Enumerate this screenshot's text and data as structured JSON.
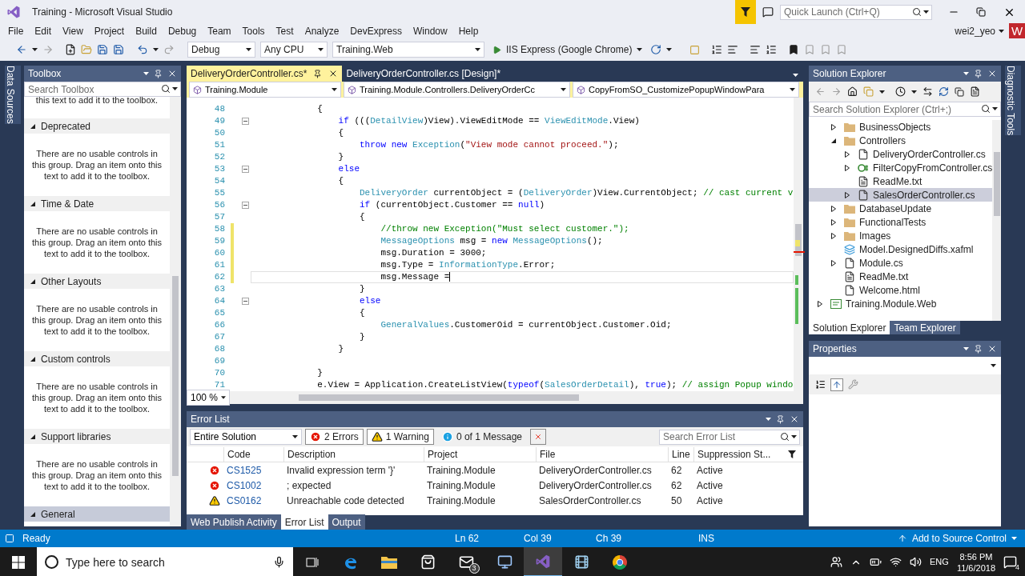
{
  "window": {
    "title": "Training - Microsoft Visual Studio"
  },
  "quick_launch": {
    "placeholder": "Quick Launch (Ctrl+Q)"
  },
  "menu": [
    "File",
    "Edit",
    "View",
    "Project",
    "Build",
    "Debug",
    "Team",
    "Tools",
    "Test",
    "Analyze",
    "DevExpress",
    "Window",
    "Help"
  ],
  "account": {
    "user": "wei2_yeo",
    "initial": "W"
  },
  "toolbar": {
    "configuration": "Debug",
    "platform": "Any CPU",
    "startup_project": "Training.Web",
    "run_target": "IIS Express (Google Chrome)"
  },
  "left_side_tabs": [
    "Data Sources"
  ],
  "right_side_tabs": [
    "Diagnostic Tools"
  ],
  "toolbox": {
    "title": "Toolbox",
    "search": {
      "placeholder": "Search Toolbox"
    },
    "top_text": "this text to add it to the toolbox.",
    "groups": [
      {
        "name": "Deprecated",
        "expanded": true,
        "selected": false,
        "message": "There are no usable controls in this group. Drag an item onto this text to add it to the toolbox."
      },
      {
        "name": "Time & Date",
        "expanded": true,
        "selected": false,
        "message": "There are no usable controls in this group. Drag an item onto this text to add it to the toolbox."
      },
      {
        "name": "Other Layouts",
        "expanded": true,
        "selected": false,
        "message": "There are no usable controls in this group. Drag an item onto this text to add it to the toolbox."
      },
      {
        "name": "Custom controls",
        "expanded": true,
        "selected": false,
        "message": "There are no usable controls in this group. Drag an item onto this text to add it to the toolbox."
      },
      {
        "name": "Support libraries",
        "expanded": true,
        "selected": false,
        "message": "There are no usable controls in this group. Drag an item onto this text to add it to the toolbox."
      },
      {
        "name": "General",
        "expanded": true,
        "selected": true
      }
    ]
  },
  "editor": {
    "tabs": [
      {
        "label": "DeliveryOrderController.cs*",
        "selected": true
      },
      {
        "label": "DeliveryOrderController.cs [Design]*",
        "selected": false
      }
    ],
    "navigation": [
      "Training.Module",
      "Training.Module.Controllers.DeliveryOrderCc",
      "CopyFromSO_CustomizePopupWindowPara"
    ],
    "lines": [
      {
        "number": "48",
        "changed": false,
        "fold": false,
        "current": false,
        "tokens": [
          {
            "kind": "plain",
            "text": "            {"
          }
        ]
      },
      {
        "number": "49",
        "changed": false,
        "fold": true,
        "current": false,
        "tokens": [
          {
            "kind": "keyword",
            "text": "                if"
          },
          {
            "kind": "plain",
            "text": " ((("
          },
          {
            "kind": "type",
            "text": "DetailView"
          },
          {
            "kind": "plain",
            "text": ")View).ViewEditMode == "
          },
          {
            "kind": "type",
            "text": "ViewEditMode"
          },
          {
            "kind": "plain",
            "text": ".View)"
          }
        ]
      },
      {
        "number": "50",
        "changed": false,
        "fold": false,
        "current": false,
        "tokens": [
          {
            "kind": "plain",
            "text": "                {"
          }
        ]
      },
      {
        "number": "51",
        "changed": false,
        "fold": false,
        "current": false,
        "tokens": [
          {
            "kind": "keyword",
            "text": "                    throw"
          },
          {
            "kind": "keyword",
            "text": " new"
          },
          {
            "kind": "type",
            "text": " Exception"
          },
          {
            "kind": "plain",
            "text": "("
          },
          {
            "kind": "string",
            "text": "\"View mode cannot proceed.\""
          },
          {
            "kind": "plain",
            "text": ");"
          }
        ]
      },
      {
        "number": "52",
        "changed": false,
        "fold": false,
        "current": false,
        "tokens": [
          {
            "kind": "plain",
            "text": "                }"
          }
        ]
      },
      {
        "number": "53",
        "changed": false,
        "fold": true,
        "current": false,
        "tokens": [
          {
            "kind": "keyword",
            "text": "                else"
          }
        ]
      },
      {
        "number": "54",
        "changed": false,
        "fold": false,
        "current": false,
        "tokens": [
          {
            "kind": "plain",
            "text": "                {"
          }
        ]
      },
      {
        "number": "55",
        "changed": false,
        "fold": false,
        "current": false,
        "tokens": [
          {
            "kind": "type",
            "text": "                    DeliveryOrder"
          },
          {
            "kind": "plain",
            "text": " currentObject = ("
          },
          {
            "kind": "type",
            "text": "DeliveryOrder"
          },
          {
            "kind": "plain",
            "text": ")View.CurrentObject; "
          },
          {
            "kind": "comment",
            "text": "// cast current v"
          }
        ]
      },
      {
        "number": "56",
        "changed": false,
        "fold": true,
        "current": false,
        "tokens": [
          {
            "kind": "keyword",
            "text": "                    if"
          },
          {
            "kind": "plain",
            "text": " (currentObject.Customer == "
          },
          {
            "kind": "keyword",
            "text": "null"
          },
          {
            "kind": "plain",
            "text": ")"
          }
        ]
      },
      {
        "number": "57",
        "changed": false,
        "fold": false,
        "current": false,
        "tokens": [
          {
            "kind": "plain",
            "text": "                    {"
          }
        ]
      },
      {
        "number": "58",
        "changed": true,
        "fold": false,
        "current": false,
        "tokens": [
          {
            "kind": "comment",
            "text": "                        //throw new Exception(\"Must select customer.\");"
          }
        ]
      },
      {
        "number": "59",
        "changed": true,
        "fold": false,
        "current": false,
        "tokens": [
          {
            "kind": "type",
            "text": "                        MessageOptions"
          },
          {
            "kind": "plain",
            "text": " msg = "
          },
          {
            "kind": "keyword",
            "text": "new"
          },
          {
            "kind": "type",
            "text": " MessageOptions"
          },
          {
            "kind": "plain",
            "text": "();"
          }
        ]
      },
      {
        "number": "60",
        "changed": true,
        "fold": false,
        "current": false,
        "tokens": [
          {
            "kind": "plain",
            "text": "                        msg.Duration = 3000;"
          }
        ]
      },
      {
        "number": "61",
        "changed": true,
        "fold": false,
        "current": false,
        "tokens": [
          {
            "kind": "plain",
            "text": "                        msg.Type = "
          },
          {
            "kind": "type",
            "text": "InformationType"
          },
          {
            "kind": "plain",
            "text": ".Error;"
          }
        ]
      },
      {
        "number": "62",
        "changed": true,
        "fold": false,
        "current": true,
        "tokens": [
          {
            "kind": "plain",
            "text": "                        msg.Message ="
          }
        ]
      },
      {
        "number": "63",
        "changed": false,
        "fold": false,
        "current": false,
        "tokens": [
          {
            "kind": "plain",
            "text": "                    }"
          }
        ]
      },
      {
        "number": "64",
        "changed": false,
        "fold": true,
        "current": false,
        "tokens": [
          {
            "kind": "keyword",
            "text": "                    else"
          }
        ]
      },
      {
        "number": "65",
        "changed": false,
        "fold": false,
        "current": false,
        "tokens": [
          {
            "kind": "plain",
            "text": "                    {"
          }
        ]
      },
      {
        "number": "66",
        "changed": false,
        "fold": false,
        "current": false,
        "tokens": [
          {
            "kind": "type",
            "text": "                        GeneralValues"
          },
          {
            "kind": "plain",
            "text": ".CustomerOid = currentObject.Customer.Oid;"
          }
        ]
      },
      {
        "number": "67",
        "changed": false,
        "fold": false,
        "current": false,
        "tokens": [
          {
            "kind": "plain",
            "text": "                    }"
          }
        ]
      },
      {
        "number": "68",
        "changed": false,
        "fold": false,
        "current": false,
        "tokens": [
          {
            "kind": "plain",
            "text": "                }"
          }
        ]
      },
      {
        "number": "69",
        "changed": false,
        "fold": false,
        "current": false
      },
      {
        "number": "70",
        "changed": false,
        "fold": false,
        "current": false,
        "tokens": [
          {
            "kind": "plain",
            "text": "            }"
          }
        ]
      },
      {
        "number": "71",
        "changed": false,
        "fold": false,
        "current": false,
        "tokens": [
          {
            "kind": "plain",
            "text": "            e.View = Application.CreateListView("
          },
          {
            "kind": "keyword",
            "text": "typeof"
          },
          {
            "kind": "plain",
            "text": "("
          },
          {
            "kind": "type",
            "text": "SalesOrderDetail"
          },
          {
            "kind": "plain",
            "text": "), "
          },
          {
            "kind": "keyword",
            "text": "true"
          },
          {
            "kind": "plain",
            "text": "); "
          },
          {
            "kind": "comment",
            "text": "// assign Popup windo"
          }
        ]
      }
    ],
    "zoom": "100 %"
  },
  "error_list": {
    "title": "Error List",
    "scope": "Entire Solution",
    "filters": [
      {
        "kind": "error",
        "label": "2 Errors",
        "selected": true
      },
      {
        "kind": "warning",
        "label": "1 Warning",
        "selected": true
      },
      {
        "kind": "info",
        "label": "0 of 1 Message",
        "selected": false
      }
    ],
    "search": {
      "placeholder": "Search Error List"
    },
    "columns": [
      "Code",
      "Description",
      "Project",
      "File",
      "Line",
      "Suppression St..."
    ],
    "rows": [
      {
        "kind": "error",
        "code": "CS1525",
        "description": "Invalid expression term '}'",
        "project": "Training.Module",
        "file": "DeliveryOrderController.cs",
        "line": "62",
        "suppression": "Active"
      },
      {
        "kind": "error",
        "code": "CS1002",
        "description": "; expected",
        "project": "Training.Module",
        "file": "DeliveryOrderController.cs",
        "line": "62",
        "suppression": "Active"
      },
      {
        "kind": "warning",
        "code": "CS0162",
        "description": "Unreachable code detected",
        "project": "Training.Module",
        "file": "SalesOrderController.cs",
        "line": "50",
        "suppression": "Active"
      }
    ]
  },
  "bottom_tabs": [
    {
      "label": "Web Publish Activity",
      "selected": false
    },
    {
      "label": "Error List",
      "selected": true
    },
    {
      "label": "Output",
      "selected": false
    }
  ],
  "solution_explorer": {
    "title": "Solution Explorer",
    "search": {
      "placeholder": "Search Solution Explorer (Ctrl+;)"
    },
    "module_items": [
      {
        "label": "BusinessObjects",
        "kind": "folder",
        "expanded": false,
        "selected": false
      },
      {
        "label": "Controllers",
        "kind": "folder",
        "expanded": true,
        "selected": false,
        "children": [
          {
            "label": "DeliveryOrderController.cs",
            "kind": "code-file",
            "expanded": false,
            "selected": false
          },
          {
            "label": "FilterCopyFromController.cs",
            "kind": "csharp-file",
            "expanded": false,
            "selected": false
          },
          {
            "label": "ReadMe.txt",
            "kind": "text-file",
            "selected": false
          },
          {
            "label": "SalesOrderController.cs",
            "kind": "code-file",
            "expanded": false,
            "selected": true
          }
        ]
      },
      {
        "label": "DatabaseUpdate",
        "kind": "folder",
        "expanded": false,
        "selected": false
      },
      {
        "label": "FunctionalTests",
        "kind": "folder",
        "expanded": false,
        "selected": false
      },
      {
        "label": "Images",
        "kind": "folder",
        "expanded": false,
        "selected": false
      },
      {
        "label": "Model.DesignedDiffs.xafml",
        "kind": "model",
        "selected": false
      },
      {
        "label": "Module.cs",
        "kind": "code-file",
        "expanded": false,
        "selected": false
      },
      {
        "label": "ReadMe.txt",
        "kind": "text-file",
        "selected": false
      },
      {
        "label": "Welcome.html",
        "kind": "code-file",
        "selected": false
      }
    ],
    "projects": [
      {
        "label": "Training.Module.Web",
        "kind": "project",
        "expanded": false,
        "selected": false
      }
    ],
    "tabs": [
      {
        "label": "Solution Explorer",
        "selected": true
      },
      {
        "label": "Team Explorer",
        "selected": false
      }
    ]
  },
  "properties": {
    "title": "Properties"
  },
  "status_bar": {
    "state": "Ready",
    "line": "Ln 62",
    "column": "Col 39",
    "char": "Ch 39",
    "mode": "INS",
    "source_control": "Add to Source Control"
  },
  "taskbar": {
    "search_placeholder": "Type here to search",
    "apps": [
      {
        "kind": "task-view",
        "active": false
      },
      {
        "kind": "edge",
        "active": false
      },
      {
        "kind": "explorer",
        "active": false
      },
      {
        "kind": "store",
        "active": false
      },
      {
        "kind": "mail",
        "active": false,
        "badge": "3"
      },
      {
        "kind": "remote",
        "active": false
      },
      {
        "kind": "visual-studio",
        "active": true
      },
      {
        "kind": "media",
        "active": false
      },
      {
        "kind": "chrome",
        "active": false
      }
    ],
    "language": "ENG",
    "time": "8:56 PM",
    "date": "11/6/2018",
    "notifications": "4"
  }
}
